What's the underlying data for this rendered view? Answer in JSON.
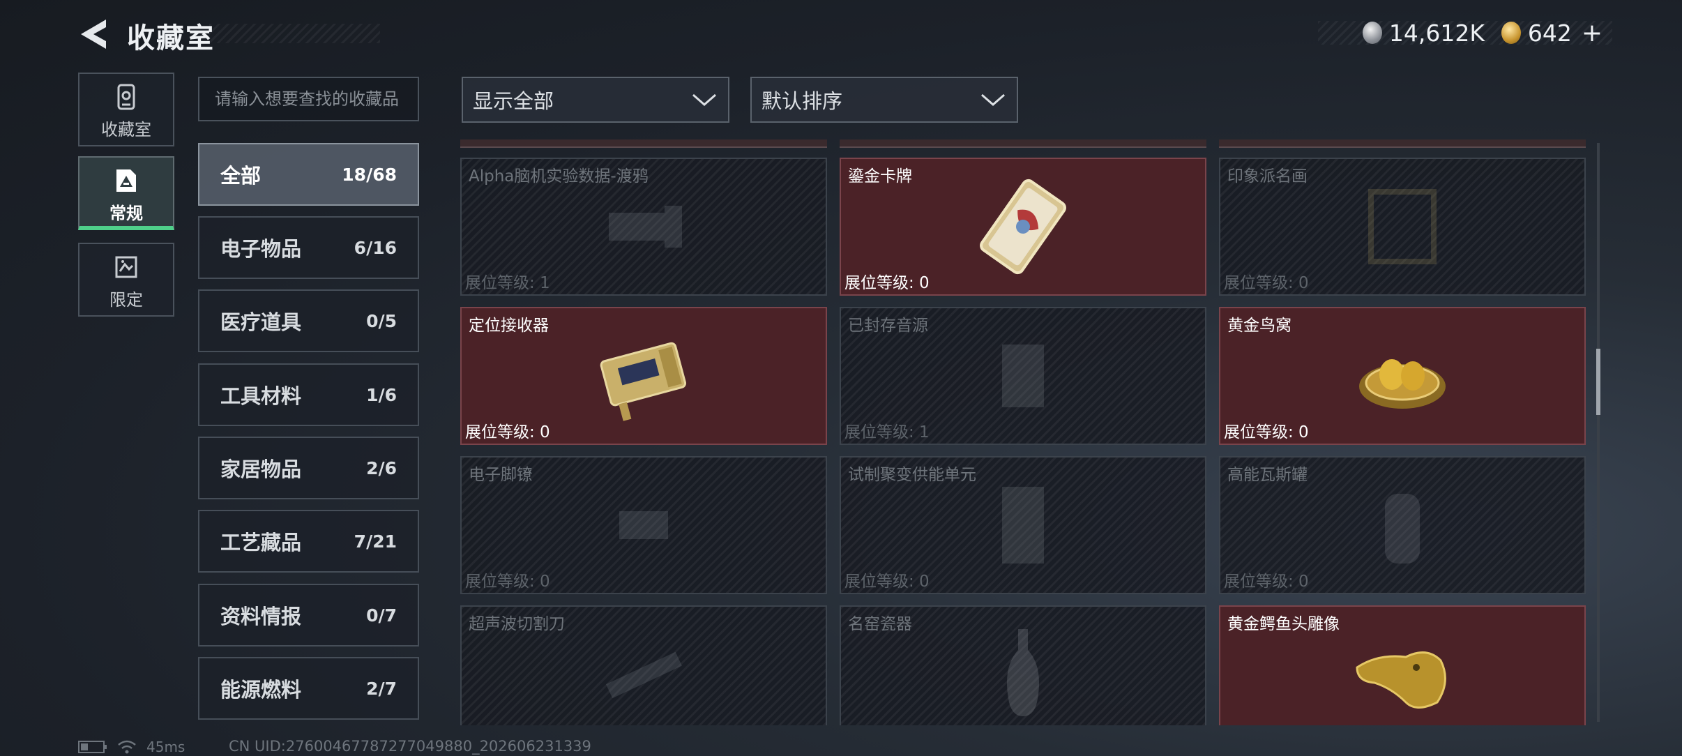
{
  "header": {
    "title": "收藏室",
    "currency_silver": "14,612K",
    "currency_gold": "642",
    "add_symbol": "+"
  },
  "side_tabs": [
    {
      "label": "收藏室"
    },
    {
      "label": "常规"
    },
    {
      "label": "限定"
    }
  ],
  "search": {
    "placeholder": "请输入想要查找的收藏品"
  },
  "filters": {
    "display": "显示全部",
    "sort": "默认排序"
  },
  "categories": [
    {
      "name": "全部",
      "count": "18/68"
    },
    {
      "name": "电子物品",
      "count": "6/16"
    },
    {
      "name": "医疗道具",
      "count": "0/5"
    },
    {
      "name": "工具材料",
      "count": "1/6"
    },
    {
      "name": "家居物品",
      "count": "2/6"
    },
    {
      "name": "工艺藏品",
      "count": "7/21"
    },
    {
      "name": "资料情报",
      "count": "0/7"
    },
    {
      "name": "能源燃料",
      "count": "2/7"
    }
  ],
  "items": [
    {
      "name": "Alpha脑机实验数据-渡鸦",
      "level": "展位等级: 1",
      "owned": false,
      "icon": "brain-device-icon"
    },
    {
      "name": "鎏金卡牌",
      "level": "展位等级: 0",
      "owned": true,
      "icon": "gilded-card-icon"
    },
    {
      "name": "印象派名画",
      "level": "展位等级: 0",
      "owned": false,
      "icon": "painting-icon"
    },
    {
      "name": "定位接收器",
      "level": "展位等级: 0",
      "owned": true,
      "icon": "receiver-icon"
    },
    {
      "name": "已封存音源",
      "level": "展位等级: 1",
      "owned": false,
      "icon": "audio-source-icon"
    },
    {
      "name": "黄金鸟窝",
      "level": "展位等级: 0",
      "owned": true,
      "icon": "golden-nest-icon"
    },
    {
      "name": "电子脚镣",
      "level": "展位等级: 0",
      "owned": false,
      "icon": "ankle-monitor-icon"
    },
    {
      "name": "试制聚变供能单元",
      "level": "展位等级: 0",
      "owned": false,
      "icon": "fusion-unit-icon"
    },
    {
      "name": "高能瓦斯罐",
      "level": "展位等级: 0",
      "owned": false,
      "icon": "gas-canister-icon"
    },
    {
      "name": "超声波切割刀",
      "level": "",
      "owned": false,
      "icon": "ultrasonic-cutter-icon"
    },
    {
      "name": "名窑瓷器",
      "level": "",
      "owned": false,
      "icon": "porcelain-vase-icon"
    },
    {
      "name": "黄金鳄鱼头雕像",
      "level": "",
      "owned": true,
      "icon": "golden-crocodile-icon"
    }
  ],
  "status": {
    "ping": "45ms",
    "uid": "CN UID:27600467787277049880_202606231339"
  },
  "colors": {
    "owned_card": "#4b2227",
    "active_tab_accent": "#4fd08a",
    "background": "#1c2129"
  }
}
